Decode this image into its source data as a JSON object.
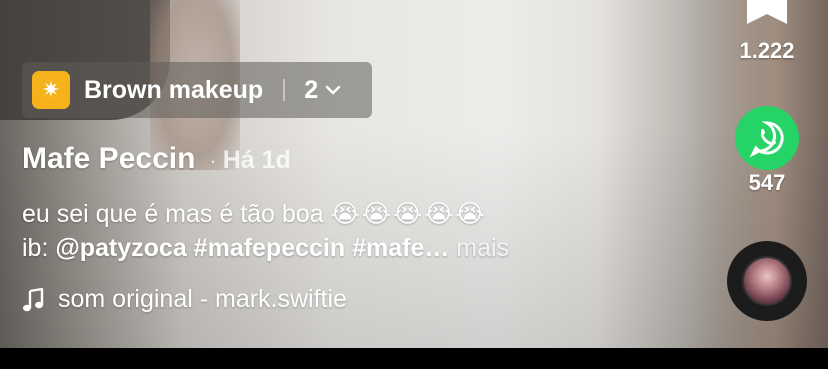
{
  "effect": {
    "icon": "sparkle-effect-icon",
    "name": "Brown makeup",
    "count": "2",
    "accent_color": "#f5b21a"
  },
  "post": {
    "author": "Mafe Peccin",
    "separator": "·",
    "time": "Há 1d",
    "caption_line1": "eu sei que é mas é tão boa",
    "caption_emojis": "😭😭😭😭😭",
    "caption_prefix": "ib:",
    "caption_tags": "@patyzoca #mafepeccin #mafe…",
    "more_label": "mais"
  },
  "sound": {
    "icon": "music-note-icon",
    "label": "som original - mark.swiftie"
  },
  "actions": {
    "bookmark_count": "1.222",
    "share_count": "547",
    "share_color": "#25d366"
  }
}
